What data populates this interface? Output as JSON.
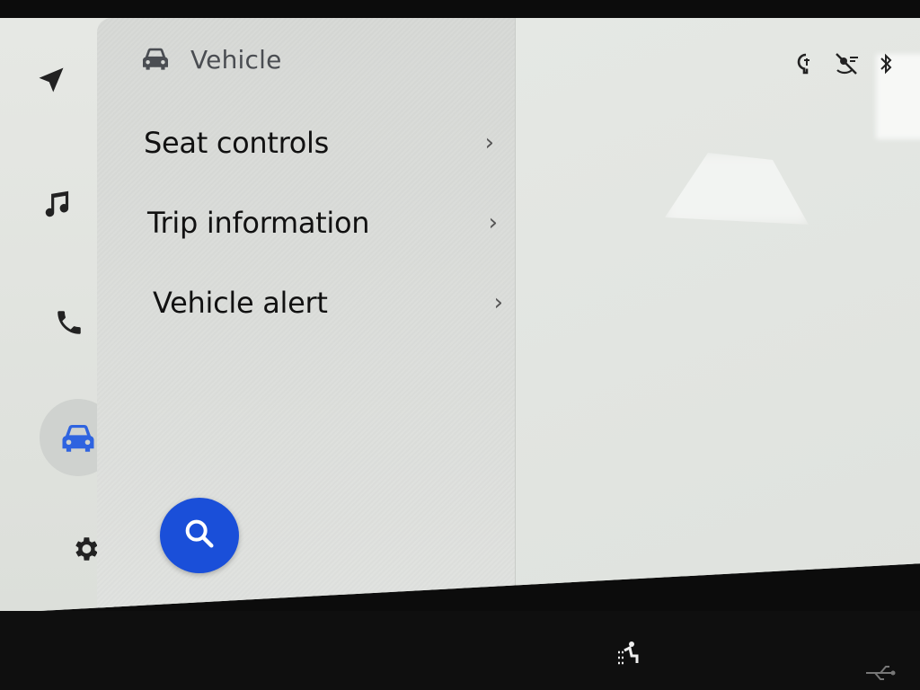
{
  "header": {
    "title": "Vehicle",
    "icon": "car-icon"
  },
  "menu": {
    "items": [
      {
        "label": "Seat controls",
        "icon": "chevron-right-icon"
      },
      {
        "label": "Trip information",
        "icon": "chevron-right-icon"
      },
      {
        "label": "Vehicle alert",
        "icon": "chevron-right-icon"
      }
    ],
    "chevron": "›"
  },
  "nav": {
    "items": [
      {
        "name": "navigation",
        "icon": "navigation-arrow-icon",
        "active": false
      },
      {
        "name": "music",
        "icon": "music-note-icon",
        "active": false
      },
      {
        "name": "phone",
        "icon": "phone-icon",
        "active": false
      },
      {
        "name": "vehicle",
        "icon": "car-icon",
        "active": true
      },
      {
        "name": "settings",
        "icon": "gear-icon",
        "active": false
      }
    ]
  },
  "status_icons": [
    "wireless-charging-icon",
    "voice-muted-icon",
    "bluetooth-icon"
  ],
  "search_button": {
    "icon": "search-icon"
  },
  "colors": {
    "accent": "#1a4fd9",
    "active_icon": "#2e63e0",
    "icon_default": "#222222"
  }
}
